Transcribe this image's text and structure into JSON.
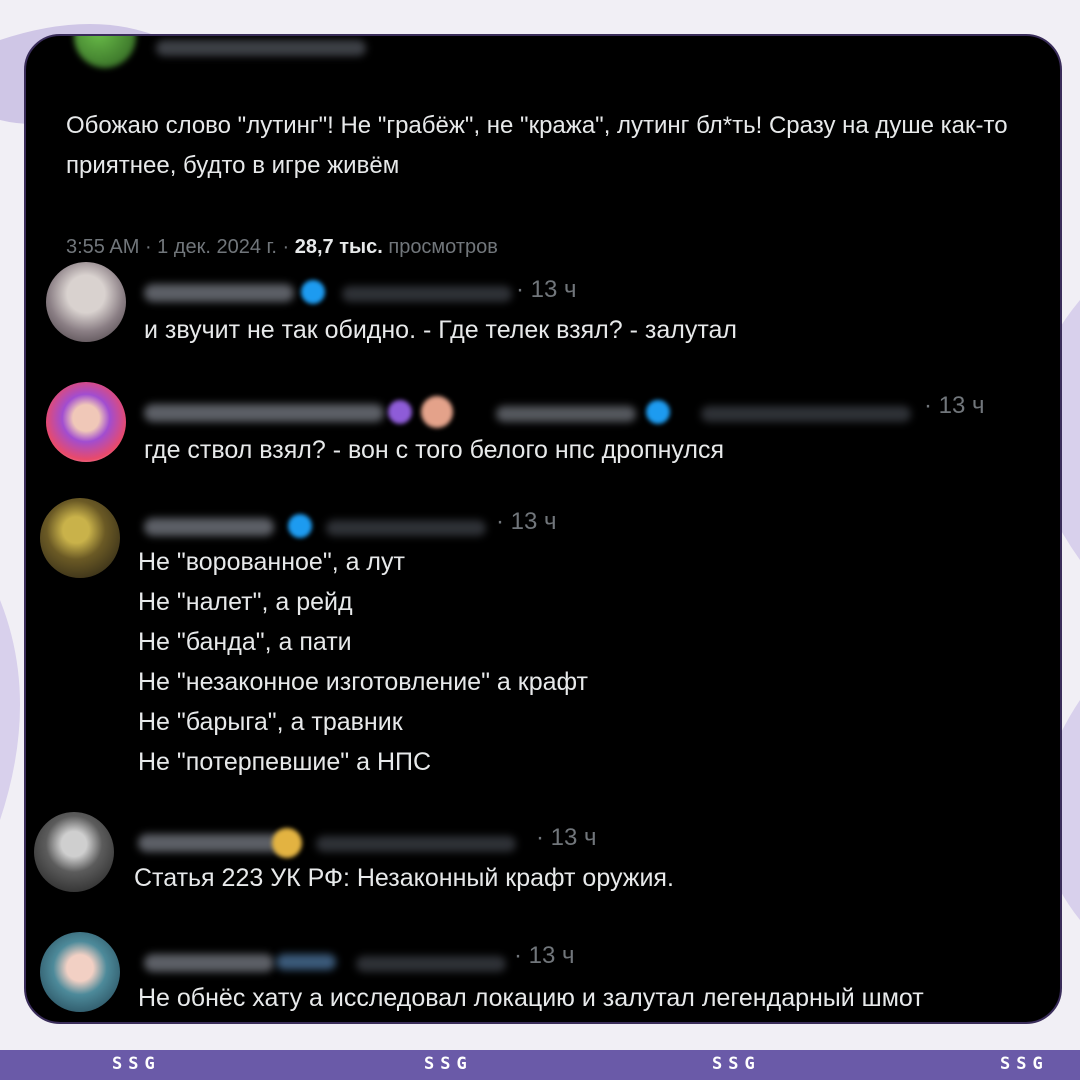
{
  "post": {
    "text": "Обожаю слово \"лутинг\"! Не \"грабёж\", не \"кража\", лутинг бл*ть! Сразу на душе как-то приятнее, будто в игре живём",
    "time": "3:55 AM",
    "date": "1 дек. 2024 г.",
    "views_count": "28,7 тыс.",
    "views_label": "просмотров"
  },
  "replies": [
    {
      "time": "· 13 ч",
      "lines": [
        "и звучит не так обидно. - Где телек взял? - залутал"
      ]
    },
    {
      "time": "· 13 ч",
      "lines": [
        "где ствол взял? - вон с того белого нпс дропнулся"
      ]
    },
    {
      "time": "· 13 ч",
      "lines": [
        "Не \"ворованное\", а лут",
        "Не \"налет\", а рейд",
        "Не \"банда\", а пати",
        "Не \"незаконное изготовление\" а крафт",
        "Не \"барыга\", а травник",
        "Не \"потерпевшие\" а НПС"
      ]
    },
    {
      "time": "· 13 ч",
      "lines": [
        "Статья 223 УК РФ: Незаконный крафт оружия."
      ]
    },
    {
      "time": "· 13 ч",
      "lines": [
        "Не обнёс хату а исследовал локацию и залутал легендарный шмот"
      ]
    }
  ],
  "footer": {
    "label": "SSG"
  },
  "colors": {
    "background": "#000000",
    "text": "#e7e9ea",
    "muted": "#71767b",
    "verified": "#1d9bf0",
    "footer": "#6a5aa8"
  }
}
